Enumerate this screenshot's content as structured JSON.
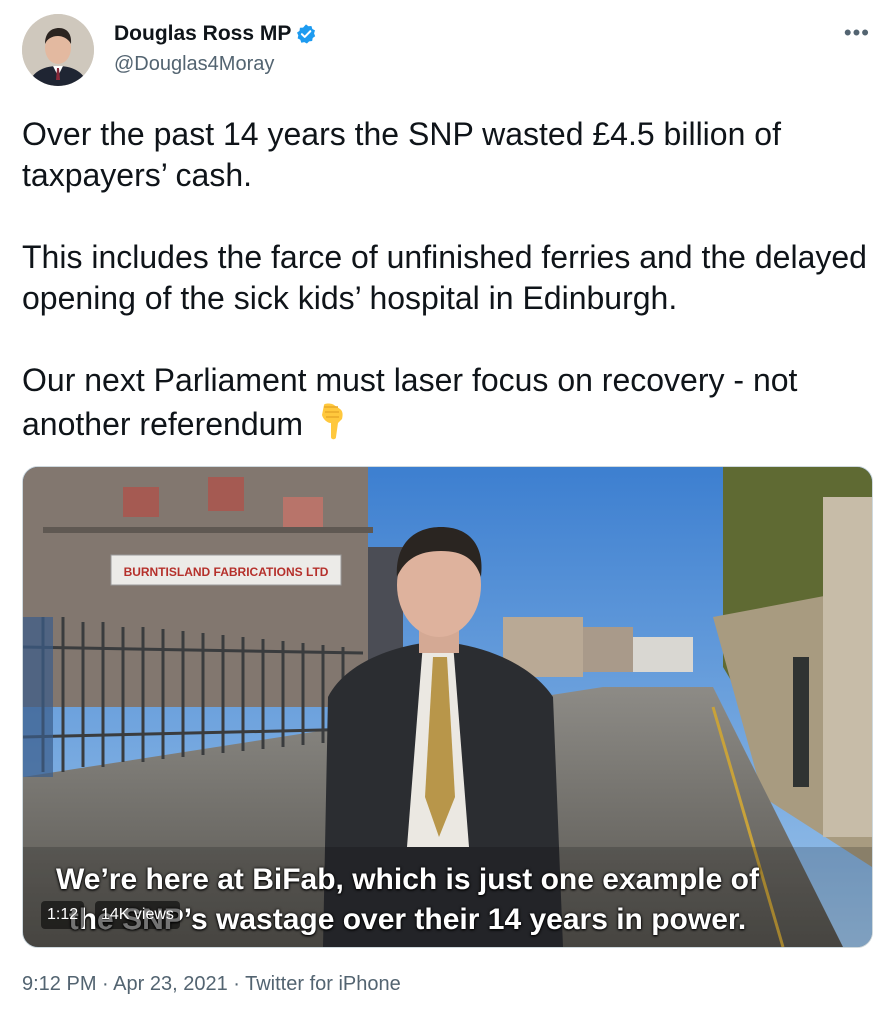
{
  "author": {
    "display_name": "Douglas Ross MP",
    "handle": "@Douglas4Moray",
    "verified": true,
    "verified_color": "#1d9bf0"
  },
  "menu_icon": "more-horizontal-icon",
  "tweet": {
    "paragraphs": [
      "Over the past 14 years the SNP wasted £4.5 billion of taxpayers’ cash.",
      "This includes the farce of unfinished ferries and the delayed opening of the sick kids’ hospital in Edinburgh.",
      "Our next Parliament must laser focus on recovery - not another referendum"
    ],
    "emoji": "backhand-index-pointing-down"
  },
  "video": {
    "sign_text": "BURNTISLAND FABRICATIONS LTD",
    "caption_line1": "We’re here at BiFab, which is just one example of",
    "caption_line2": "the SNP’s wastage over their 14 years in power.",
    "duration": "1:12",
    "views": "14K views"
  },
  "meta": {
    "time": "9:12 PM",
    "sep1": " · ",
    "date": "Apr 23, 2021",
    "sep2": " · ",
    "source": "Twitter for iPhone"
  }
}
